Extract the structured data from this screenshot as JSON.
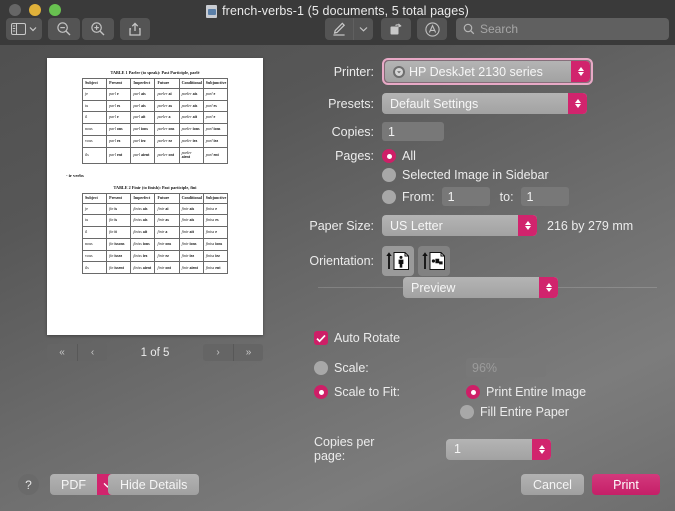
{
  "window": {
    "title": "french-verbs-1 (5 documents, 5 total pages)",
    "doc_icon": "document-icon",
    "traffic_lights": [
      "close",
      "minimize",
      "zoom"
    ]
  },
  "toolbar": {
    "sidebar_label": "sidebar-icon",
    "zoom_out_label": "zoom-out-icon",
    "zoom_in_label": "zoom-in-icon",
    "share_label": "share-icon",
    "markup_label": "markup-pen-icon",
    "markup_arrow": "chevron-down-icon",
    "rotate_label": "rotate-icon",
    "annotate_label": "annotate-icon",
    "search": {
      "value": "",
      "placeholder": "Search"
    }
  },
  "preview": {
    "tables": [
      {
        "title": "TABLE 1  Parler (to speak): Past Participle, parlé",
        "headers": [
          "Subject",
          "Present",
          "Imperfect",
          "Future",
          "Conditional",
          "Subjunctive"
        ],
        "rows": [
          [
            "je",
            [
              "parl",
              "e"
            ],
            [
              "parl",
              "ais"
            ],
            [
              "parler",
              "ai"
            ],
            [
              "parler",
              "ais"
            ],
            [
              "parl",
              "e"
            ]
          ],
          [
            "tu",
            [
              "parl",
              "es"
            ],
            [
              "parl",
              "ais"
            ],
            [
              "parler",
              "as"
            ],
            [
              "parler",
              "ais"
            ],
            [
              "parl",
              "es"
            ]
          ],
          [
            "il",
            [
              "parl",
              "e"
            ],
            [
              "parl",
              "ait"
            ],
            [
              "parler",
              "a"
            ],
            [
              "parler",
              "ait"
            ],
            [
              "parl",
              "e"
            ]
          ],
          [
            "nous",
            [
              "parl",
              "ons"
            ],
            [
              "parl",
              "ions"
            ],
            [
              "parler",
              "ons"
            ],
            [
              "parler",
              "ions"
            ],
            [
              "parl",
              "ions"
            ]
          ],
          [
            "vous",
            [
              "parl",
              "ez"
            ],
            [
              "parl",
              "iez"
            ],
            [
              "parler",
              "ez"
            ],
            [
              "parler",
              "iez"
            ],
            [
              "parl",
              "iez"
            ]
          ],
          [
            "ils",
            [
              "parl",
              "ent"
            ],
            [
              "parl",
              "aient"
            ],
            [
              "parler",
              "ont"
            ],
            [
              "parler",
              "aient"
            ],
            [
              "parl",
              "ent"
            ]
          ]
        ]
      },
      {
        "title": "TABLE 2  Finir (to finish): Past participle, fini",
        "headers": [
          "Subject",
          "Present",
          "Imperfect",
          "Future",
          "Conditional",
          "Subjunctive"
        ],
        "rows": [
          [
            "je",
            [
              "fin",
              "is"
            ],
            [
              "finiss",
              "ais"
            ],
            [
              "finir",
              "ai"
            ],
            [
              "finir",
              "ais"
            ],
            [
              "finiss",
              "e"
            ]
          ],
          [
            "tu",
            [
              "fin",
              "is"
            ],
            [
              "finiss",
              "ais"
            ],
            [
              "finir",
              "as"
            ],
            [
              "finir",
              "ais"
            ],
            [
              "finiss",
              "es"
            ]
          ],
          [
            "il",
            [
              "fin",
              "it"
            ],
            [
              "finiss",
              "ait"
            ],
            [
              "finir",
              "a"
            ],
            [
              "finir",
              "ait"
            ],
            [
              "finiss",
              "e"
            ]
          ],
          [
            "nous",
            [
              "fin",
              "issons"
            ],
            [
              "finiss",
              "ions"
            ],
            [
              "finir",
              "ons"
            ],
            [
              "finir",
              "ions"
            ],
            [
              "finiss",
              "ions"
            ]
          ],
          [
            "vous",
            [
              "fin",
              "issez"
            ],
            [
              "finiss",
              "iez"
            ],
            [
              "finir",
              "ez"
            ],
            [
              "finir",
              "iez"
            ],
            [
              "finiss",
              "iez"
            ]
          ],
          [
            "ils",
            [
              "fin",
              "issent"
            ],
            [
              "finiss",
              "aient"
            ],
            [
              "finir",
              "ont"
            ],
            [
              "finir",
              "aient"
            ],
            [
              "finiss",
              "ent"
            ]
          ]
        ]
      }
    ],
    "section_heading": "- ir verbs",
    "nav": {
      "first": "«",
      "prev": "‹",
      "counter": "1 of 5",
      "next": "›",
      "last": "»"
    }
  },
  "settings": {
    "printer": {
      "label": "Printer:",
      "value": "HP DeskJet 2130 series",
      "focused": true
    },
    "presets": {
      "label": "Presets:",
      "value": "Default Settings"
    },
    "copies": {
      "label": "Copies:",
      "value": "1"
    },
    "pages": {
      "label": "Pages:",
      "options": [
        {
          "text": "All",
          "selected": true
        },
        {
          "text": "Selected Image in Sidebar",
          "selected": false
        },
        {
          "text": "From:",
          "selected": false
        }
      ],
      "from_value": "1",
      "to_label": "to:",
      "to_value": "1"
    },
    "paper_size": {
      "label": "Paper Size:",
      "value": "US Letter",
      "dimensions": "216 by 279 mm"
    },
    "orientation": {
      "label": "Orientation:",
      "portrait_icon": "orientation-portrait-icon",
      "landscape_icon": "orientation-landscape-icon",
      "selected": "portrait"
    },
    "pane": {
      "value": "Preview"
    },
    "auto_rotate": {
      "label": "Auto Rotate",
      "checked": true
    },
    "scale": {
      "label": "Scale:",
      "selected": false,
      "value": "96%"
    },
    "scale_to_fit": {
      "label": "Scale to Fit:",
      "selected": true,
      "options": [
        {
          "text": "Print Entire Image",
          "selected": true
        },
        {
          "text": "Fill Entire Paper",
          "selected": false
        }
      ]
    },
    "copies_per_page": {
      "label": "Copies per page:",
      "value": "1"
    }
  },
  "footer": {
    "help": "?",
    "pdf": "PDF",
    "pdf_arrow": "chevron-down-icon",
    "hide_details": "Hide Details",
    "cancel": "Cancel",
    "print": "Print"
  },
  "colors": {
    "accent": "#ce1f67",
    "focus_ring": "#e8a9c6",
    "titlebar": "#3a3a3a",
    "paper": "#ffffff"
  }
}
